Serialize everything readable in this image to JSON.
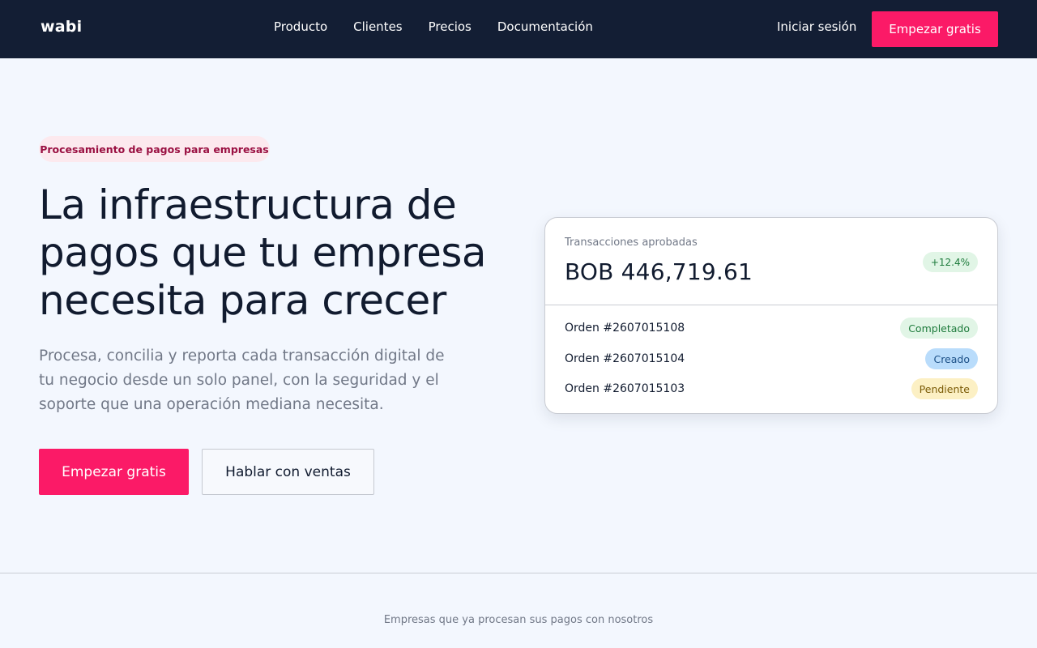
{
  "nav": {
    "logo": "wabi",
    "links": [
      "Producto",
      "Clientes",
      "Precios",
      "Documentación"
    ],
    "login": "Iniciar sesión",
    "cta": "Empezar gratis"
  },
  "hero": {
    "badge": "Procesamiento de pagos para empresas",
    "title": "La infraestructura de pagos que tu empresa necesita para crecer",
    "subtitle": "Procesa, concilia y reporta cada transacción digital de tu negocio desde un solo panel, con la seguridad y el soporte que una operación mediana necesita.",
    "primary_cta": "Empezar gratis",
    "secondary_cta": "Hablar con ventas"
  },
  "card": {
    "label": "Transacciones aprobadas",
    "amount": "BOB 446,719.61",
    "growth": "+12.4%",
    "orders": [
      {
        "id": "Orden #2607015108",
        "status": "Completado",
        "bg": "#e1f5e6",
        "fg": "#1e7b3c"
      },
      {
        "id": "Orden #2607015104",
        "status": "Creado",
        "bg": "#b9dcfb",
        "fg": "#1b4f86"
      },
      {
        "id": "Orden #2607015103",
        "status": "Pendiente",
        "bg": "#fcf0c4",
        "fg": "#7a5a05"
      }
    ]
  },
  "trust": {
    "text": "Empresas que ya procesan sus pagos con nosotros"
  }
}
